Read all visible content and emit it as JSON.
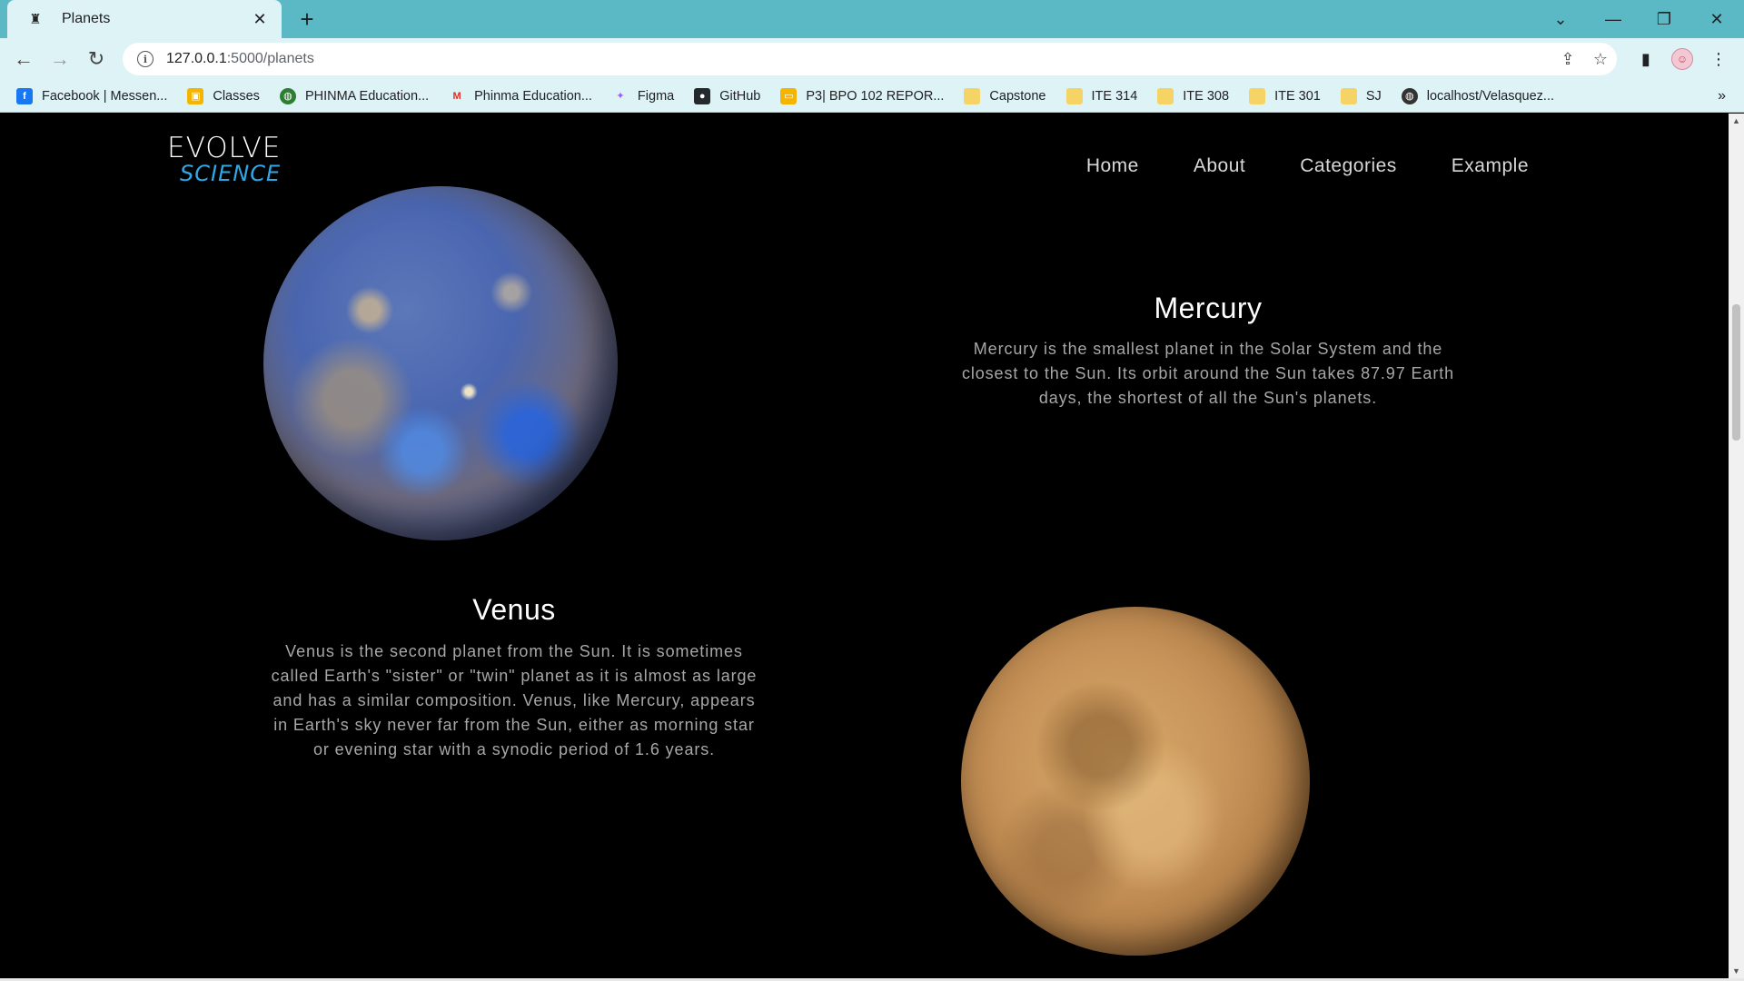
{
  "browser": {
    "tab_title": "Planets",
    "url_host": "127.0.0.1",
    "url_path": ":5000/planets",
    "bookmarks": [
      {
        "label": "Facebook | Messen...",
        "icon": "facebook-icon",
        "color": "#1877f2",
        "glyph": "f"
      },
      {
        "label": "Classes",
        "icon": "classroom-icon",
        "color": "#f4b400",
        "glyph": "▣"
      },
      {
        "label": "PHINMA Education...",
        "icon": "globe-icon",
        "color": "#2e7d32",
        "glyph": "◍"
      },
      {
        "label": "Phinma Education...",
        "icon": "gmail-icon",
        "color": "#ffffff",
        "glyph": "M"
      },
      {
        "label": "Figma",
        "icon": "figma-icon",
        "color": "#ffffff",
        "glyph": "✦"
      },
      {
        "label": "GitHub",
        "icon": "github-icon",
        "color": "#24292e",
        "glyph": "●"
      },
      {
        "label": "P3| BPO 102 REPOR...",
        "icon": "slides-icon",
        "color": "#f4b400",
        "glyph": "▭"
      },
      {
        "label": "Capstone",
        "icon": "folder-icon",
        "color": "#f6d365",
        "glyph": ""
      },
      {
        "label": "ITE 314",
        "icon": "folder-icon",
        "color": "#f6d365",
        "glyph": ""
      },
      {
        "label": "ITE 308",
        "icon": "folder-icon",
        "color": "#f6d365",
        "glyph": ""
      },
      {
        "label": "ITE 301",
        "icon": "folder-icon",
        "color": "#f6d365",
        "glyph": ""
      },
      {
        "label": "SJ",
        "icon": "folder-icon",
        "color": "#f6d365",
        "glyph": ""
      },
      {
        "label": "localhost/Velasquez...",
        "icon": "globe-icon",
        "color": "#333333",
        "glyph": "◍"
      }
    ],
    "more_bookmarks": "»"
  },
  "site": {
    "logo_line1": "EVOLVE",
    "logo_line2": "SCIENCE",
    "nav": [
      "Home",
      "About",
      "Categories",
      "Example"
    ]
  },
  "planets": [
    {
      "name": "Mercury",
      "description": "Mercury is the smallest planet in the Solar System and the closest to the Sun. Its orbit around the Sun takes 87.97 Earth days, the shortest of all the Sun's planets."
    },
    {
      "name": "Venus",
      "description": "Venus is the second planet from the Sun. It is sometimes called Earth's \"sister\" or \"twin\" planet as it is almost as large and has a similar composition. Venus, like Mercury, appears in Earth's sky never far from the Sun, either as morning star or evening star with a synodic period of 1.6 years."
    }
  ]
}
